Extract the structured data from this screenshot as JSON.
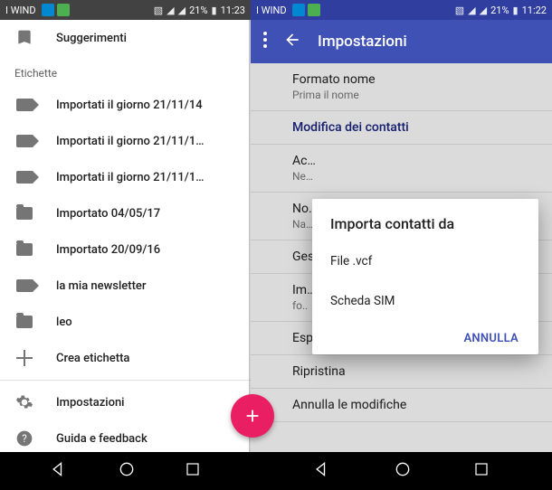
{
  "left": {
    "status": {
      "carrier": "I WIND",
      "battery": "21%",
      "time": "11:23"
    },
    "top_item": "Suggerimenti",
    "section": "Etichette",
    "labels": [
      "Importati il giorno 21/11/14",
      "Importati il giorno 21/11/1…",
      "Importati il giorno 21/11/1…",
      "Importato 04/05/17",
      "Importato 20/09/16",
      "la mia newsletter",
      "leo"
    ],
    "create": "Crea etichetta",
    "settings": "Impostazioni",
    "help": "Guida e feedback"
  },
  "right": {
    "status": {
      "carrier": "I WIND",
      "battery": "21%",
      "time": "11:22"
    },
    "appbar_title": "Impostazioni",
    "rows": {
      "name_format": {
        "title": "Formato nome",
        "sub": "Prima il nome"
      },
      "edit_contacts": "Modifica dei contatti",
      "accounts": {
        "title": "Ac…",
        "sub": "Ne…"
      },
      "name": {
        "title": "No…",
        "sub": "Na…"
      },
      "ges": "Ges…",
      "import": "Im…",
      "fo": "fo..",
      "export": "Esporta",
      "restore": "Ripristina",
      "undo": "Annulla le modifiche"
    },
    "dialog": {
      "title": "Importa contatti da",
      "opt_vcf": "File .vcf",
      "opt_sim": "Scheda SIM",
      "cancel": "ANNULLA"
    }
  }
}
